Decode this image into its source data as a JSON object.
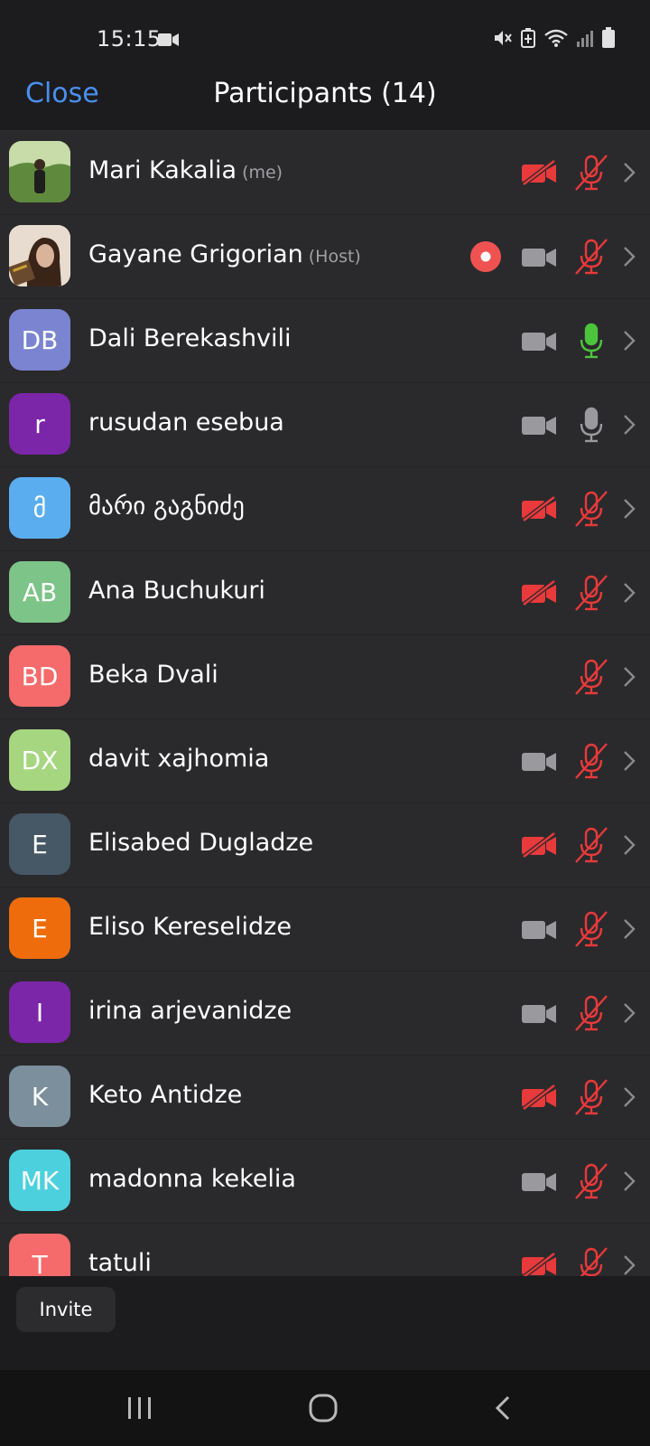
{
  "status": {
    "time": "15:15",
    "icons": [
      "video-recording-icon",
      "mute-icon",
      "battery-saver-icon",
      "wifi-icon",
      "signal-icon",
      "battery-icon"
    ]
  },
  "header": {
    "close_label": "Close",
    "title": "Participants (14)"
  },
  "colors": {
    "accent": "#4a8ff0",
    "muted_red": "#e8393b",
    "active_green": "#4cc43c",
    "gray_icon": "#9a9a9e",
    "row_bg": "#2a2a2c"
  },
  "participants": [
    {
      "name": "Mari Kakalia",
      "tag": "(me)",
      "avatar_text": "",
      "avatar_color": "#6b8e4e",
      "photo": true,
      "recording": false,
      "video": "off",
      "audio": "muted"
    },
    {
      "name": "Gayane Grigorian",
      "tag": "(Host)",
      "avatar_text": "",
      "avatar_color": "#c9b8a8",
      "photo": true,
      "recording": true,
      "video": "on",
      "audio": "muted"
    },
    {
      "name": "Dali Berekashvili",
      "tag": "",
      "avatar_text": "DB",
      "avatar_color": "#7a84d0",
      "photo": false,
      "recording": false,
      "video": "on",
      "audio": "speaking"
    },
    {
      "name": "rusudan esebua",
      "tag": "",
      "avatar_text": "r",
      "avatar_color": "#7b25a8",
      "photo": false,
      "recording": false,
      "video": "on",
      "audio": "unmuted"
    },
    {
      "name": "მარი გაგნიძე",
      "tag": "",
      "avatar_text": "მ",
      "avatar_color": "#5aaef0",
      "photo": false,
      "recording": false,
      "video": "off",
      "audio": "muted"
    },
    {
      "name": "Ana Buchukuri",
      "tag": "",
      "avatar_text": "AB",
      "avatar_color": "#7cc487",
      "photo": false,
      "recording": false,
      "video": "off",
      "audio": "muted"
    },
    {
      "name": "Beka Dvali",
      "tag": "",
      "avatar_text": "BD",
      "avatar_color": "#f56a6a",
      "photo": false,
      "recording": false,
      "video": "none",
      "audio": "muted"
    },
    {
      "name": "davit xajhomia",
      "tag": "",
      "avatar_text": "DX",
      "avatar_color": "#a6d67f",
      "photo": false,
      "recording": false,
      "video": "on",
      "audio": "muted"
    },
    {
      "name": "Elisabed Dugladze",
      "tag": "",
      "avatar_text": "E",
      "avatar_color": "#465766",
      "photo": false,
      "recording": false,
      "video": "off",
      "audio": "muted"
    },
    {
      "name": "Eliso Kereselidze",
      "tag": "",
      "avatar_text": "E",
      "avatar_color": "#ef6c0c",
      "photo": false,
      "recording": false,
      "video": "on",
      "audio": "muted"
    },
    {
      "name": "irina arjevanidze",
      "tag": "",
      "avatar_text": "I",
      "avatar_color": "#7b25a8",
      "photo": false,
      "recording": false,
      "video": "on",
      "audio": "muted"
    },
    {
      "name": "Keto Antidze",
      "tag": "",
      "avatar_text": "K",
      "avatar_color": "#7c8f9c",
      "photo": false,
      "recording": false,
      "video": "off",
      "audio": "muted"
    },
    {
      "name": "madonna kekelia",
      "tag": "",
      "avatar_text": "MK",
      "avatar_color": "#4dd0de",
      "photo": false,
      "recording": false,
      "video": "on",
      "audio": "muted"
    },
    {
      "name": "tatuli",
      "tag": "",
      "avatar_text": "T",
      "avatar_color": "#f56a6a",
      "photo": false,
      "recording": false,
      "video": "off",
      "audio": "muted"
    }
  ],
  "footer": {
    "invite_label": "Invite"
  },
  "navbar": {
    "items": [
      "recent-apps-icon",
      "home-icon",
      "back-icon"
    ]
  }
}
